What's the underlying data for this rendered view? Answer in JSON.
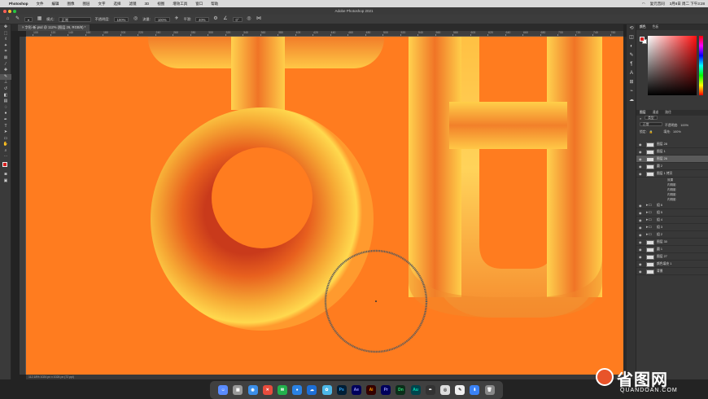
{
  "menubar": {
    "app_name": "Photoshop",
    "items": [
      "文件",
      "编辑",
      "图像",
      "图层",
      "文字",
      "选择",
      "滤镜",
      "3D",
      "视图",
      "增效工具",
      "窗口",
      "帮助"
    ],
    "right": [
      "复元音同",
      "3月8日 周二 下午3:28"
    ]
  },
  "window": {
    "title": "Adobe Photoshop 2021"
  },
  "options": {
    "mode_label": "模式:",
    "mode_value": "正常",
    "opacity_label": "不透明度:",
    "opacity_value": "100%",
    "flow_label": "流量:",
    "flow_value": "100%",
    "smooth_label": "平滑:",
    "smooth_value": "40%",
    "angle_value": "0°"
  },
  "document": {
    "tab_label": "字形-新.psd @ 112% (图层 26, RGB/8) *"
  },
  "ruler": {
    "ticks": [
      "100",
      "120",
      "140",
      "160",
      "180",
      "200",
      "220",
      "240",
      "260",
      "280",
      "300",
      "320",
      "340",
      "360",
      "380",
      "400",
      "420",
      "440",
      "460",
      "480",
      "500",
      "520",
      "540",
      "560",
      "580",
      "600",
      "620",
      "640",
      "660",
      "680",
      "700",
      "720",
      "740",
      "760"
    ]
  },
  "status": {
    "text": "112.18%   1024 px x 1024 px (72 ppi)"
  },
  "colors": {
    "canvas": "#ff7c1f",
    "accent": "#ffd24a",
    "foreground": "#d81f1f",
    "background": "#ffffff"
  },
  "panels": {
    "color_tabs": [
      "颜色",
      "色板"
    ],
    "layers_tabs": [
      "图层",
      "通道",
      "路径"
    ],
    "kind_filter": "类型",
    "blend_mode": "正常",
    "opacity_label": "不透明度:",
    "opacity_value": "100%",
    "lock_label": "锁定:",
    "fill_label": "填充:",
    "fill_value": "100%",
    "layers": [
      {
        "name": "图层 28",
        "type": "layer"
      },
      {
        "name": "图层 1",
        "type": "layer"
      },
      {
        "name": "图层 26",
        "type": "layer",
        "selected": true
      },
      {
        "name": "圆 2",
        "type": "layer"
      },
      {
        "name": "图层 1 拷贝",
        "type": "layer"
      },
      {
        "name": "效果",
        "type": "fx"
      },
      {
        "name": "内阴影",
        "type": "fx"
      },
      {
        "name": "内阴影",
        "type": "fx"
      },
      {
        "name": "内阴影",
        "type": "fx"
      },
      {
        "name": "内阴影",
        "type": "fx"
      },
      {
        "name": "组 6",
        "type": "folder"
      },
      {
        "name": "组 5",
        "type": "folder"
      },
      {
        "name": "组 4",
        "type": "folder"
      },
      {
        "name": "组 3",
        "type": "folder"
      },
      {
        "name": "组 2",
        "type": "folder"
      },
      {
        "name": "图层 30",
        "type": "layer"
      },
      {
        "name": "圆 1",
        "type": "layer"
      },
      {
        "name": "图层 27",
        "type": "layer"
      },
      {
        "name": "颜色填充 1",
        "type": "layer"
      },
      {
        "name": "背景",
        "type": "layer"
      }
    ]
  },
  "dock": {
    "apps": [
      "Ps",
      "Ae",
      "Ai",
      "Pr",
      "Dn",
      "Au"
    ]
  },
  "watermark": {
    "brand": "省图网",
    "url": "QUANDOAN.COM"
  }
}
